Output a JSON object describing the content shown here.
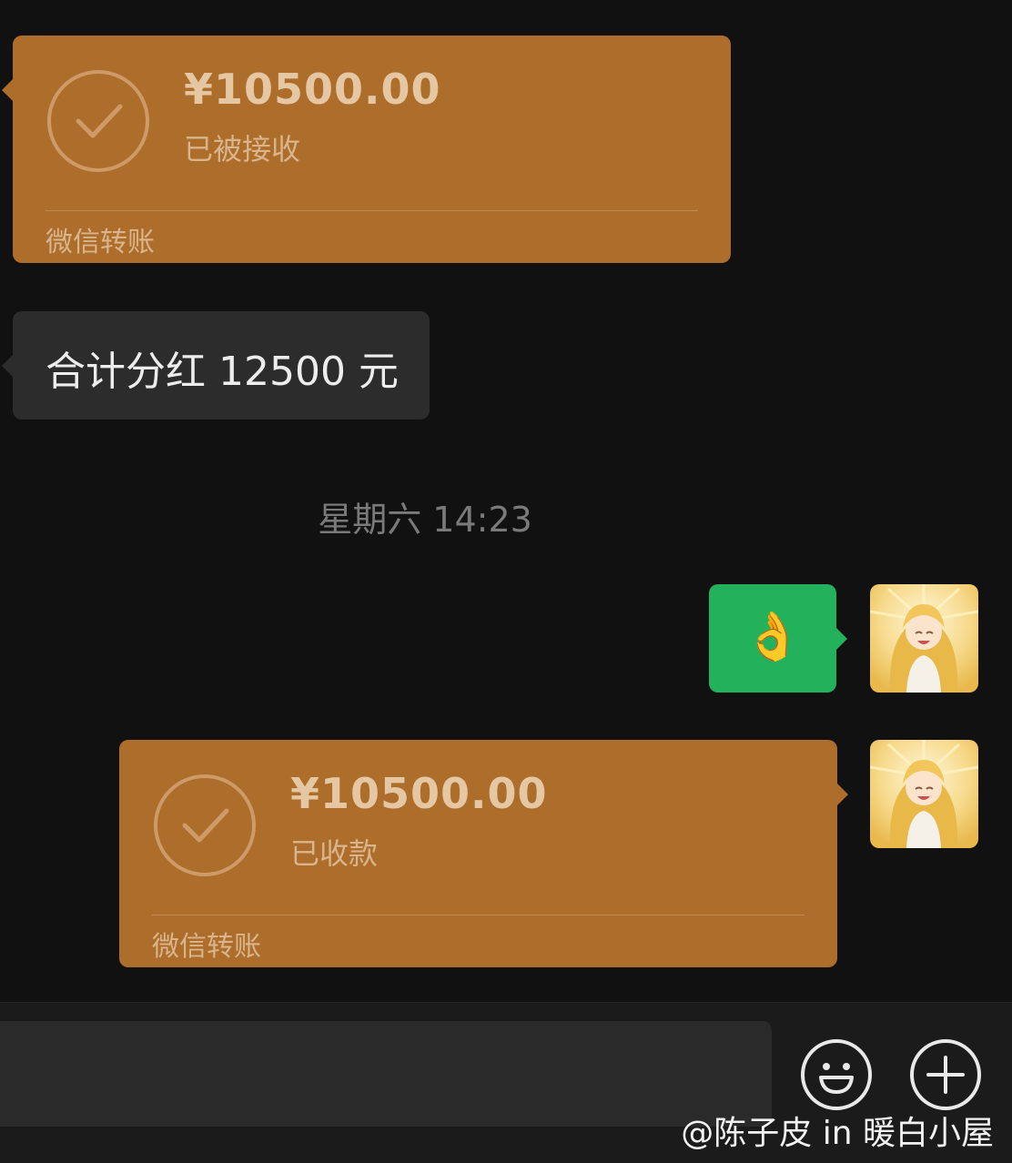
{
  "messages": {
    "transfer_received_left": {
      "amount": "¥10500.00",
      "status": "已被接收",
      "footer": "微信转账",
      "icon": "check-circle-icon"
    },
    "text_left": {
      "text": "合计分红 12500 元"
    },
    "timestamp": "星期六 14:23",
    "emoji_right": {
      "emoji": "👌"
    },
    "transfer_collected_right": {
      "amount": "¥10500.00",
      "status": "已收款",
      "footer": "微信转账",
      "icon": "check-circle-icon"
    }
  },
  "input_bar": {
    "emoji_icon": "smiley-icon",
    "plus_icon": "plus-icon"
  },
  "watermark": "@陈子皮 in 暖白小屋",
  "colors": {
    "background": "#111111",
    "transfer_card": "#AD6D2B",
    "sent_bubble": "#23B25B",
    "received_bubble": "#2C2C2C"
  }
}
